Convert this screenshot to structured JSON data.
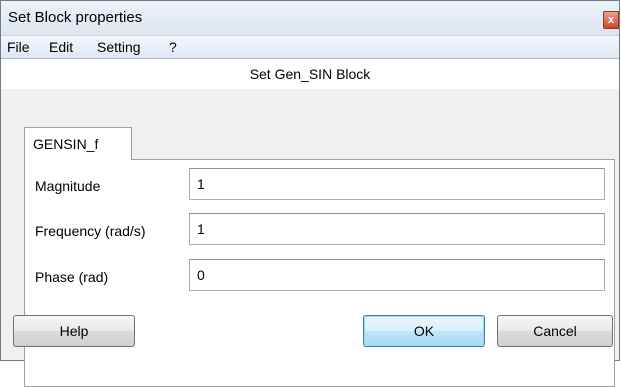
{
  "window": {
    "title": "Set Block properties",
    "close_symbol": "x"
  },
  "menu": {
    "items": [
      {
        "label": "File"
      },
      {
        "label": "Edit"
      },
      {
        "label": "Setting"
      },
      {
        "label": "?"
      }
    ]
  },
  "header": {
    "label": "Set Gen_SIN Block"
  },
  "tab": {
    "label": "GENSIN_f"
  },
  "parameters": [
    {
      "label": "Magnitude",
      "value": "1"
    },
    {
      "label": "Frequency (rad/s)",
      "value": "1"
    },
    {
      "label": "Phase (rad)",
      "value": "0"
    }
  ],
  "buttons": {
    "help": "Help",
    "ok": "OK",
    "cancel": "Cancel"
  },
  "colors": {
    "accent": "#3c7fb1",
    "close": "#c8452b"
  }
}
